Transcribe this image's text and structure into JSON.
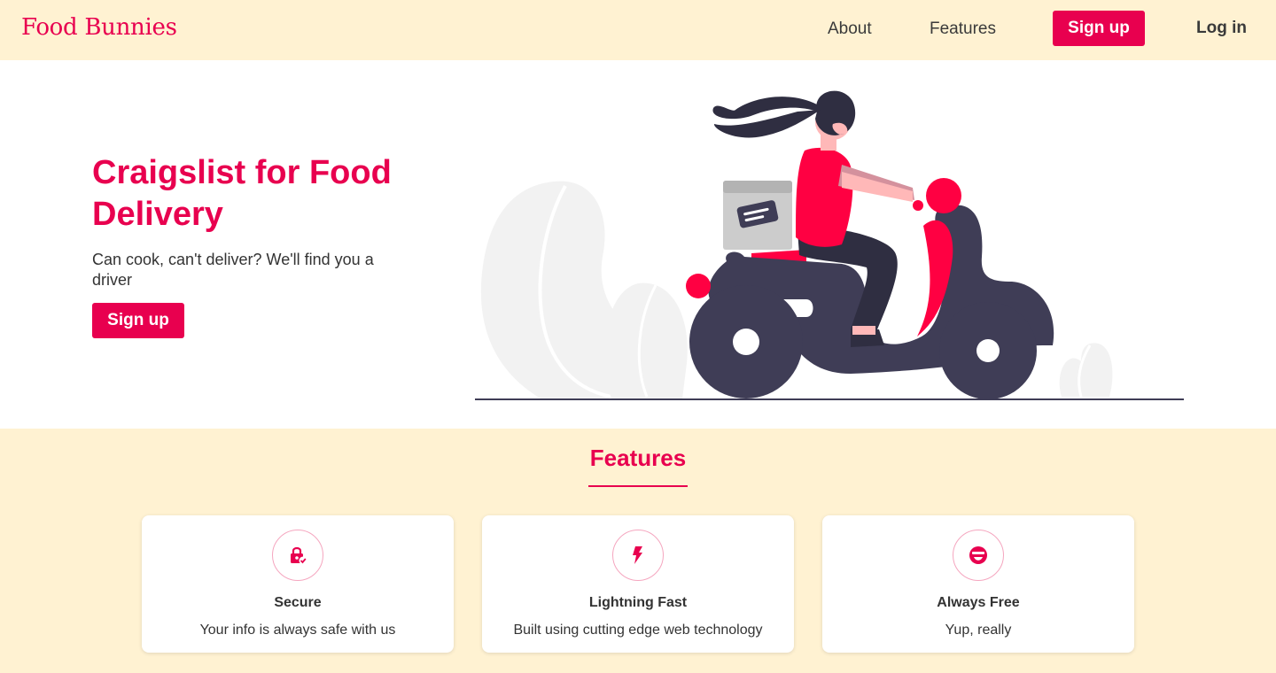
{
  "nav": {
    "logo": "Food Bunnies",
    "about": "About",
    "features": "Features",
    "signup": "Sign up",
    "login": "Log in"
  },
  "hero": {
    "title": "Craigslist for Food Delivery",
    "subtitle": "Can cook, can't deliver? We'll find you a driver",
    "signup": "Sign up"
  },
  "features": {
    "title": "Features",
    "cards": [
      {
        "icon": "lock-check-icon",
        "title": "Secure",
        "text": "Your info is always safe with us"
      },
      {
        "icon": "lightning-icon",
        "title": "Lightning Fast",
        "text": "Built using cutting edge web technology"
      },
      {
        "icon": "smile-icon",
        "title": "Always Free",
        "text": "Yup, really"
      }
    ]
  },
  "colors": {
    "brand": "#e8004f",
    "cream": "#fff2d2",
    "scooter": "#3f3d56",
    "rider_shirt": "#ff0042"
  }
}
